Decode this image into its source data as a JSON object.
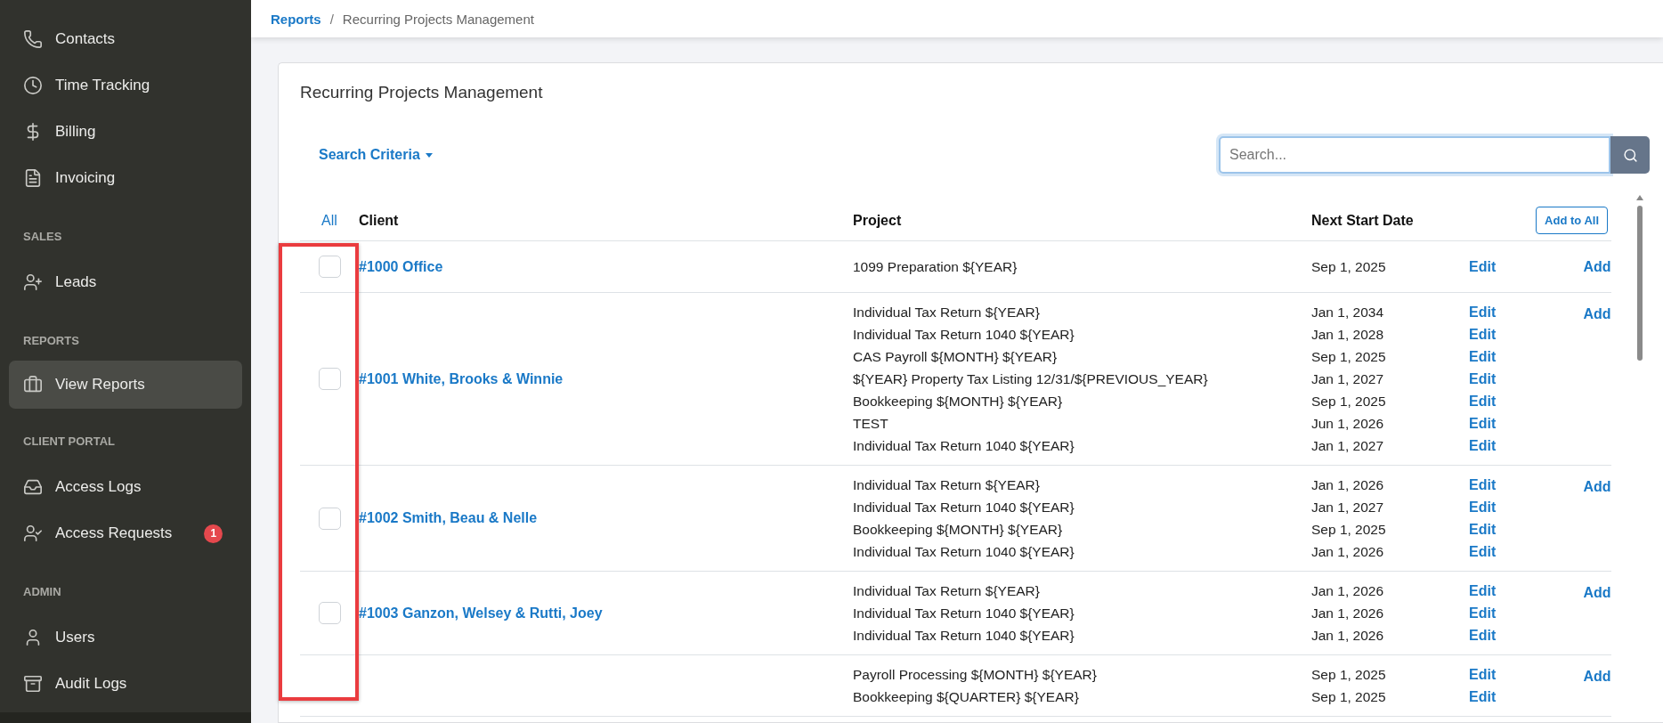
{
  "sidebar": {
    "groups": [
      {
        "items": [
          {
            "label": "Contacts",
            "selected": false
          },
          {
            "label": "Time Tracking",
            "selected": false
          },
          {
            "label": "Billing",
            "selected": false
          },
          {
            "label": "Invoicing",
            "selected": false
          }
        ]
      },
      {
        "title": "SALES",
        "items": [
          {
            "label": "Leads",
            "selected": false
          }
        ]
      },
      {
        "title": "REPORTS",
        "items": [
          {
            "label": "View Reports",
            "selected": true
          }
        ]
      },
      {
        "title": "CLIENT PORTAL",
        "items": [
          {
            "label": "Access Logs",
            "selected": false
          },
          {
            "label": "Access Requests",
            "selected": false,
            "badge": "1"
          }
        ]
      },
      {
        "title": "ADMIN",
        "items": [
          {
            "label": "Users",
            "selected": false
          },
          {
            "label": "Audit Logs",
            "selected": false
          }
        ]
      }
    ]
  },
  "breadcrumb": {
    "link": "Reports",
    "separator": "/",
    "current": "Recurring Projects Management"
  },
  "card": {
    "title": "Recurring Projects Management",
    "search_criteria": "Search Criteria",
    "search": {
      "placeholder": "Search..."
    }
  },
  "table": {
    "columns": [
      "All",
      "Client",
      "Project",
      "Next Start Date"
    ],
    "add_all_button": "Add to All",
    "highlight_checkbox_column": true,
    "rows": [
      {
        "checked": false,
        "client": "#1000 Office",
        "add": "Add",
        "projects": [
          {
            "name": "1099 Preparation ${YEAR}",
            "date": "Sep 1, 2025",
            "edit": "Edit"
          }
        ]
      },
      {
        "checked": false,
        "client": "#1001 White, Brooks & Winnie",
        "add": "Add",
        "projects": [
          {
            "name": "Individual Tax Return ${YEAR}",
            "date": "Jan 1, 2034",
            "edit": "Edit"
          },
          {
            "name": "Individual Tax Return 1040 ${YEAR}",
            "date": "Jan 1, 2028",
            "edit": "Edit"
          },
          {
            "name": "CAS Payroll ${MONTH} ${YEAR}",
            "date": "Sep 1, 2025",
            "edit": "Edit"
          },
          {
            "name": "${YEAR} Property Tax Listing 12/31/${PREVIOUS_YEAR}",
            "date": "Jan 1, 2027",
            "edit": "Edit"
          },
          {
            "name": "Bookkeeping ${MONTH} ${YEAR}",
            "date": "Sep 1, 2025",
            "edit": "Edit"
          },
          {
            "name": "TEST",
            "date": "Jun 1, 2026",
            "edit": "Edit"
          },
          {
            "name": "Individual Tax Return 1040 ${YEAR}",
            "date": "Jan 1, 2027",
            "edit": "Edit"
          }
        ]
      },
      {
        "checked": false,
        "client": "#1002 Smith, Beau & Nelle",
        "add": "Add",
        "projects": [
          {
            "name": "Individual Tax Return ${YEAR}",
            "date": "Jan 1, 2026",
            "edit": "Edit"
          },
          {
            "name": "Individual Tax Return 1040 ${YEAR}",
            "date": "Jan 1, 2027",
            "edit": "Edit"
          },
          {
            "name": "Bookkeeping ${MONTH} ${YEAR}",
            "date": "Sep 1, 2025",
            "edit": "Edit"
          },
          {
            "name": "Individual Tax Return 1040 ${YEAR}",
            "date": "Jan 1, 2026",
            "edit": "Edit"
          }
        ]
      },
      {
        "checked": false,
        "client": "#1003 Ganzon, Welsey & Rutti, Joey",
        "add": "Add",
        "projects": [
          {
            "name": "Individual Tax Return ${YEAR}",
            "date": "Jan 1, 2026",
            "edit": "Edit"
          },
          {
            "name": "Individual Tax Return 1040 ${YEAR}",
            "date": "Jan 1, 2026",
            "edit": "Edit"
          },
          {
            "name": "Individual Tax Return 1040 ${YEAR}",
            "date": "Jan 1, 2026",
            "edit": "Edit"
          }
        ]
      },
      {
        "add": "Add",
        "projects": [
          {
            "name": "Payroll Processing ${MONTH} ${YEAR}",
            "date": "Sep 1, 2025",
            "edit": "Edit"
          },
          {
            "name": "Bookkeeping ${QUARTER} ${YEAR}",
            "date": "Sep 1, 2025",
            "edit": "Edit"
          }
        ]
      }
    ]
  }
}
